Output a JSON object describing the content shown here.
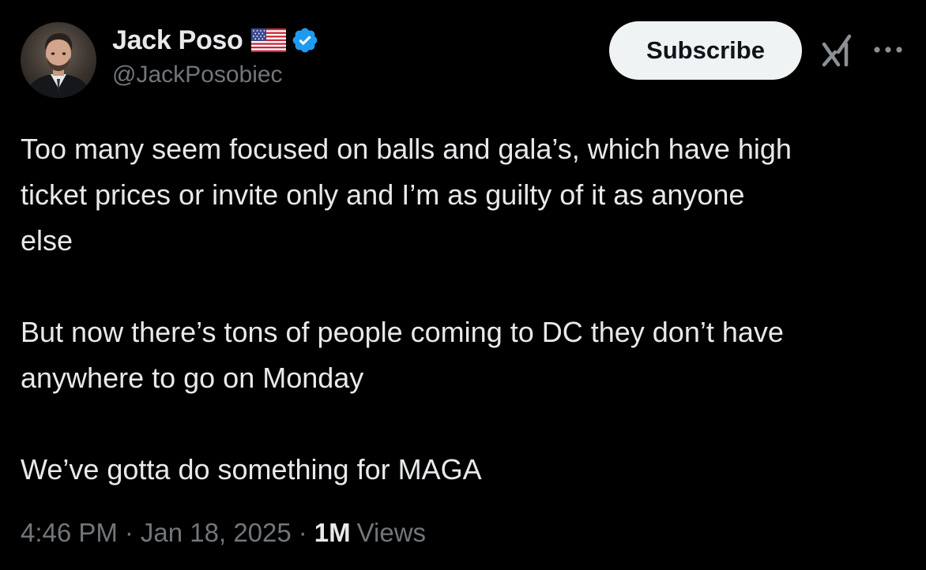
{
  "author": {
    "display_name": "Jack Poso",
    "handle": "@JackPosobiec",
    "flag_icon": "us-flag-icon",
    "verified_icon": "verified-badge-icon"
  },
  "actions": {
    "subscribe_label": "Subscribe",
    "grok_icon": "grok-icon",
    "more_icon": "more-icon"
  },
  "tweet": {
    "paragraphs": [
      [
        "Too many seem focused on balls and gala’s, which have high",
        "ticket prices or invite only and I’m as guilty of it as anyone",
        "else"
      ],
      [
        "But now there’s tons of people coming to DC they don’t have",
        "anywhere to go on Monday"
      ],
      [
        "We’ve gotta do something for MAGA"
      ]
    ]
  },
  "meta": {
    "time": "4:46 PM",
    "separator": "·",
    "date": "Jan 18, 2025",
    "views_count": "1M",
    "views_label": "Views"
  },
  "colors": {
    "background": "#000000",
    "text_primary": "#e7e9ea",
    "text_secondary": "#71767b",
    "verified_blue": "#1d9bf0",
    "button_bg": "#eff3f4",
    "button_text": "#0f1419"
  }
}
